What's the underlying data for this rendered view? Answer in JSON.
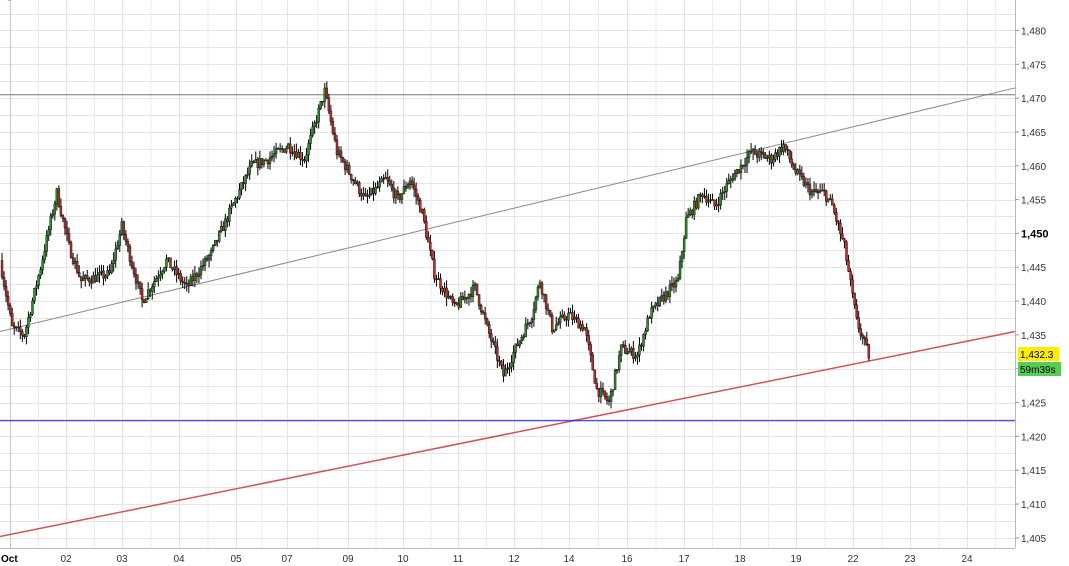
{
  "chart_data": {
    "type": "candlestick",
    "xlabel": "",
    "ylabel": "",
    "ylim": [
      1.4035,
      1.4845
    ],
    "grid": true,
    "x_tick_labels": [
      "Oct",
      "02",
      "03",
      "04",
      "05",
      "07",
      "09",
      "10",
      "11",
      "12",
      "14",
      "16",
      "17",
      "18",
      "19",
      "22",
      "23",
      "24"
    ],
    "y_ticks": [
      1.405,
      1.41,
      1.415,
      1.42,
      1.425,
      1.43,
      1.435,
      1.44,
      1.445,
      1.45,
      1.455,
      1.46,
      1.465,
      1.47,
      1.475,
      1.48
    ],
    "y_tick_labels": [
      "1,405",
      "1,410",
      "1,415",
      "1,420",
      "1,425",
      "1,430",
      "1,435",
      "1,440",
      "1,445",
      "1,450",
      "1,455",
      "1,460",
      "1,465",
      "1,470",
      "1,475",
      "1,480"
    ],
    "highlight_y_label": "1,450",
    "price_path": [
      [
        0,
        1.446
      ],
      [
        3,
        1.436
      ],
      [
        6,
        1.435
      ],
      [
        10,
        1.445
      ],
      [
        14,
        1.456
      ],
      [
        17,
        1.448
      ],
      [
        20,
        1.443
      ],
      [
        27,
        1.444
      ],
      [
        30,
        1.451
      ],
      [
        35,
        1.44
      ],
      [
        41,
        1.446
      ],
      [
        46,
        1.442
      ],
      [
        52,
        1.447
      ],
      [
        58,
        1.455
      ],
      [
        62,
        1.46
      ],
      [
        66,
        1.461
      ],
      [
        71,
        1.463
      ],
      [
        75,
        1.461
      ],
      [
        78,
        1.467
      ],
      [
        80,
        1.471
      ],
      [
        83,
        1.462
      ],
      [
        86,
        1.459
      ],
      [
        90,
        1.455
      ],
      [
        95,
        1.458
      ],
      [
        98,
        1.455
      ],
      [
        101,
        1.458
      ],
      [
        104,
        1.453
      ],
      [
        107,
        1.444
      ],
      [
        112,
        1.439
      ],
      [
        117,
        1.442
      ],
      [
        120,
        1.436
      ],
      [
        124,
        1.429
      ],
      [
        127,
        1.433
      ],
      [
        131,
        1.438
      ],
      [
        133,
        1.443
      ],
      [
        136,
        1.436
      ],
      [
        140,
        1.438
      ],
      [
        144,
        1.436
      ],
      [
        147,
        1.427
      ],
      [
        150,
        1.425
      ],
      [
        153,
        1.433
      ],
      [
        157,
        1.432
      ],
      [
        160,
        1.438
      ],
      [
        164,
        1.441
      ],
      [
        167,
        1.443
      ],
      [
        169,
        1.452
      ],
      [
        173,
        1.456
      ],
      [
        176,
        1.454
      ],
      [
        180,
        1.458
      ],
      [
        185,
        1.462
      ],
      [
        190,
        1.461
      ],
      [
        193,
        1.463
      ],
      [
        196,
        1.459
      ],
      [
        200,
        1.456
      ],
      [
        203,
        1.456
      ],
      [
        205,
        1.454
      ],
      [
        208,
        1.448
      ],
      [
        211,
        1.437
      ],
      [
        214,
        1.432
      ]
    ],
    "trendlines": [
      {
        "name": "channel-upper",
        "color": "#888888",
        "x0": 0,
        "y0": 1.4355,
        "x1": 250,
        "y1": 1.4715
      },
      {
        "name": "support-lower",
        "color": "#cc5555",
        "x0": 0,
        "y0": 1.4052,
        "x1": 250,
        "y1": 1.4355
      },
      {
        "name": "resistance-horizontal",
        "color": "#777777",
        "x0": 0,
        "y0": 1.4705,
        "x1": 250,
        "y1": 1.4705
      },
      {
        "name": "support-horizontal",
        "color": "#1a1ad6",
        "x0": 0,
        "y0": 1.4223,
        "x1": 250,
        "y1": 1.4223
      }
    ],
    "last_price_label": "1,432.3",
    "countdown_label": "59m39s",
    "last_price_color": "#ffee00",
    "countdown_color": "#55cc55"
  }
}
